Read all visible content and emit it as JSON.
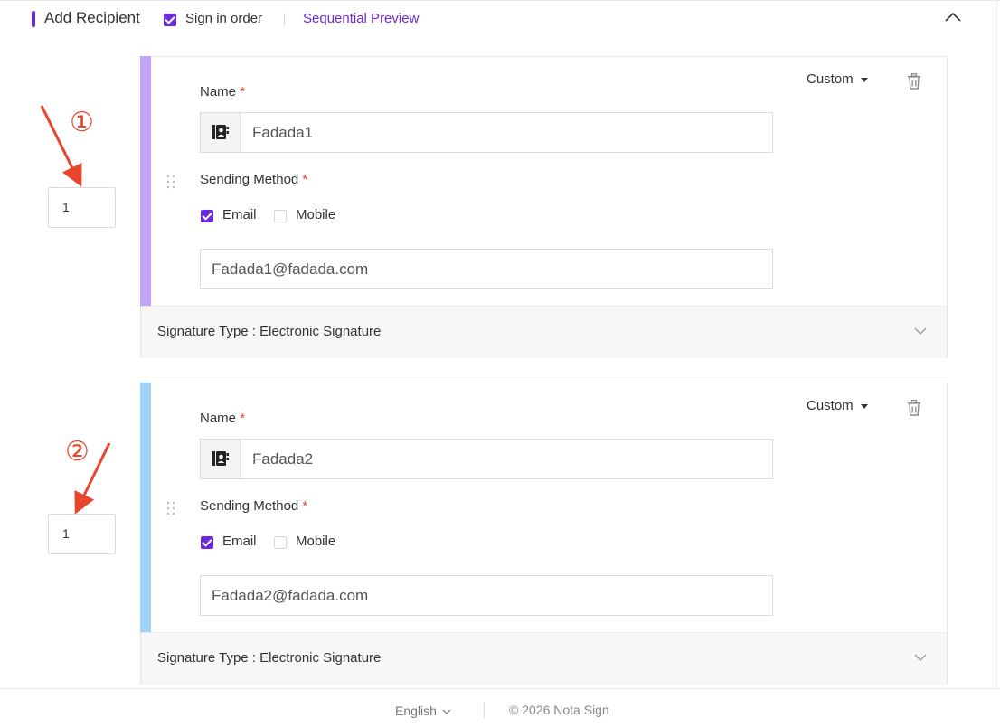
{
  "header": {
    "title": "Add Recipient",
    "sign_in_order_label": "Sign in order",
    "sign_in_order_checked": true,
    "preview_link": "Sequential Preview"
  },
  "annotations": [
    {
      "number": "①",
      "color": "#e8452e"
    },
    {
      "number": "②",
      "color": "#e8452e"
    }
  ],
  "recipients": [
    {
      "order": "1",
      "accent_color": "#c3a3f5",
      "role_select": "Custom",
      "name_label": "Name",
      "name_value": "Fadada1",
      "sending_method_label": "Sending Method",
      "email_option": "Email",
      "email_checked": true,
      "mobile_option": "Mobile",
      "mobile_checked": false,
      "email_value": "Fadada1@fadada.com",
      "signature_type": "Signature Type : Electronic Signature"
    },
    {
      "order": "1",
      "accent_color": "#9fd3f7",
      "role_select": "Custom",
      "name_label": "Name",
      "name_value": "Fadada2",
      "sending_method_label": "Sending Method",
      "email_option": "Email",
      "email_checked": true,
      "mobile_option": "Mobile",
      "mobile_checked": false,
      "email_value": "Fadada2@fadada.com",
      "signature_type": "Signature Type : Electronic Signature"
    }
  ],
  "required_mark": "*",
  "footer": {
    "language": "English",
    "copyright": "© 2026 Nota Sign"
  },
  "colors": {
    "brand_purple": "#6c2bd9",
    "required_red": "#e8452e"
  }
}
